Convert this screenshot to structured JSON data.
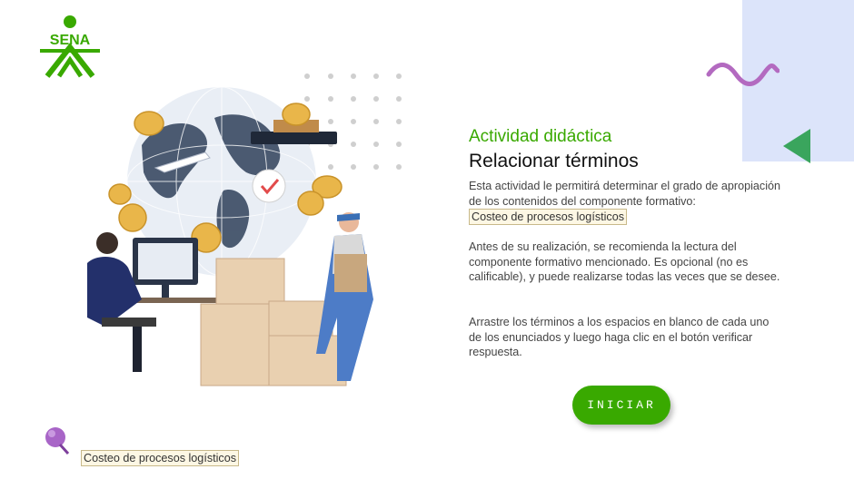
{
  "header": {
    "logo_text": "SENA"
  },
  "content": {
    "subtitle": "Actividad didáctica",
    "title": "Relacionar términos",
    "paragraph1_text": "Esta actividad le permitirá determinar el grado de apropiación de los contenidos del componente formativo:",
    "paragraph1_tag": "Costeo de procesos logísticos",
    "paragraph2": "Antes de su realización, se recomienda la lectura del componente formativo mencionado.  Es opcional (no es calificable), y puede realizarse todas las veces que se desee.",
    "paragraph3": "Arrastre los términos a los espacios en blanco de cada uno de los enunciados y luego haga clic en el botón verificar respuesta."
  },
  "actions": {
    "start_label": "INICIAR"
  },
  "footer": {
    "course_tag": "Costeo de procesos logísticos"
  },
  "colors": {
    "brand_green": "#39a900",
    "accent_purple": "#b36ac0",
    "panel_blue": "#dce4fa",
    "triangle_green": "#3aa55d"
  }
}
